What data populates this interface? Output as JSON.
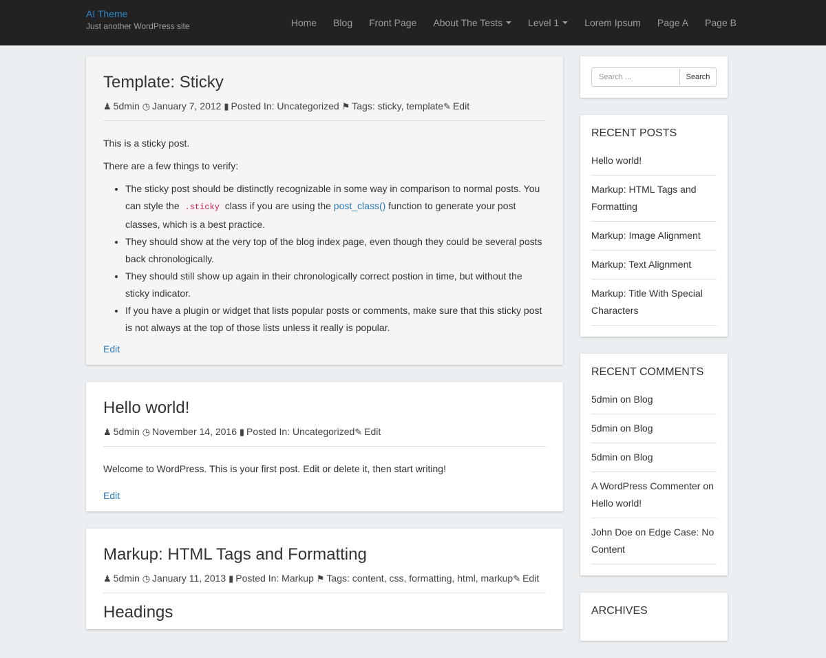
{
  "site": {
    "title": "AI Theme",
    "tagline": "Just another WordPress site"
  },
  "nav": [
    "Home",
    "Blog",
    "Front Page",
    "About The Tests",
    "Level 1",
    "Lorem Ipsum",
    "Page A",
    "Page B"
  ],
  "posts": [
    {
      "title": "Template: Sticky",
      "author": "5dmin",
      "date": "January 7, 2012",
      "posted_in_label": "Posted In:",
      "category": "Uncategorized",
      "tags_label": "Tags:",
      "tags": "sticky, template",
      "edit_label": "Edit",
      "p1": "This is a sticky post.",
      "p2": "There are a few things to verify:",
      "li1_a": "The sticky post should be distinctly recognizable in some way in comparison to normal posts. You can style the ",
      "li1_code": ".sticky",
      "li1_b": " class if you are using the ",
      "li1_link": "post_class()",
      "li1_c": " function to generate your post classes, which is a best practice.",
      "li2": "They should show at the very top of the blog index page, even though they could be several posts back chronologically.",
      "li3": "They should still show up again in their chronologically correct postion in time, but without the sticky indicator.",
      "li4": "If you have a plugin or widget that lists popular posts or comments, make sure that this sticky post is not always at the top of those lists unless it really is popular.",
      "footer_edit": "Edit"
    },
    {
      "title": "Hello world!",
      "author": "5dmin",
      "date": "November 14, 2016",
      "posted_in_label": "Posted In:",
      "category": "Uncategorized",
      "edit_label": "Edit",
      "p1": "Welcome to WordPress. This is your first post. Edit or delete it, then start writing!",
      "footer_edit": "Edit"
    },
    {
      "title": "Markup: HTML Tags and Formatting",
      "author": "5dmin",
      "date": "January 11, 2013",
      "posted_in_label": "Posted In:",
      "category": "Markup",
      "tags_label": "Tags:",
      "tags": "content, css, formatting, html, markup",
      "edit_label": "Edit",
      "subheading": "Headings"
    }
  ],
  "sidebar": {
    "search_placeholder": "Search ...",
    "search_button": "Search",
    "recent_posts_title": "RECENT POSTS",
    "recent_posts": [
      "Hello world!",
      "Markup: HTML Tags and Formatting",
      "Markup: Image Alignment",
      "Markup: Text Alignment",
      "Markup: Title With Special Characters"
    ],
    "recent_comments_title": "RECENT COMMENTS",
    "recent_comments": [
      "5dmin on Blog",
      "5dmin on Blog",
      "5dmin on Blog",
      "A WordPress Commenter on Hello world!",
      "John Doe on Edge Case: No Content"
    ],
    "archives_title": "ARCHIVES"
  },
  "icons": {
    "user": "user-icon",
    "clock": "clock-icon",
    "file": "file-icon",
    "tags": "tags-icon",
    "edit": "edit-icon"
  },
  "colors": {
    "navbar": "#222222",
    "link": "#2e7ab8",
    "brand": "#2e86c9",
    "background": "#eceff1"
  }
}
